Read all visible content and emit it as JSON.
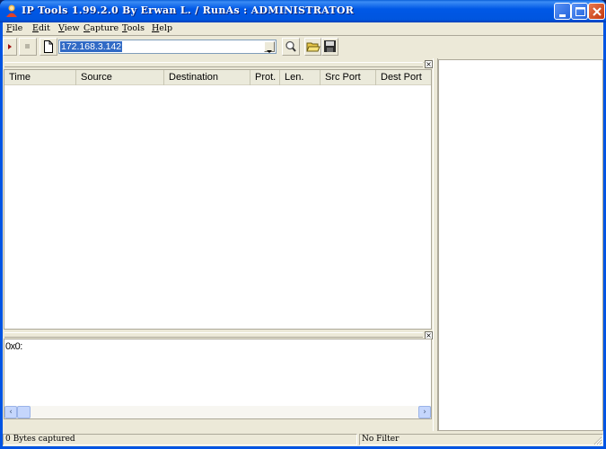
{
  "window": {
    "title": "IP Tools 1.99.2.0 By Erwan L. / RunAs : ADMINISTRATOR",
    "controls": {
      "minimize": "minimize-icon",
      "maximize": "maximize-icon",
      "close": "close-icon"
    }
  },
  "menubar": {
    "items": [
      {
        "accel": "F",
        "rest": "ile"
      },
      {
        "accel": "E",
        "rest": "dit"
      },
      {
        "accel": "V",
        "rest": "iew"
      },
      {
        "accel": "C",
        "rest": "apture"
      },
      {
        "accel": "T",
        "rest": "ools"
      },
      {
        "accel": "H",
        "rest": "elp"
      }
    ]
  },
  "toolbar": {
    "start_icon": "play-icon",
    "stop_icon": "stop-icon",
    "new_icon": "new-document-icon",
    "address_value": "172.168.3.142",
    "search_icon": "magnifier-icon",
    "open_icon": "open-folder-icon",
    "save_icon": "floppy-save-icon"
  },
  "packet_list": {
    "columns": [
      "Time",
      "Source",
      "Destination",
      "Prot.",
      "Len.",
      "Src Port",
      "Dest Port"
    ],
    "rows": []
  },
  "hex_view": {
    "text": "0x0:"
  },
  "statusbar": {
    "left": "0 Bytes captured",
    "right": "No Filter"
  }
}
